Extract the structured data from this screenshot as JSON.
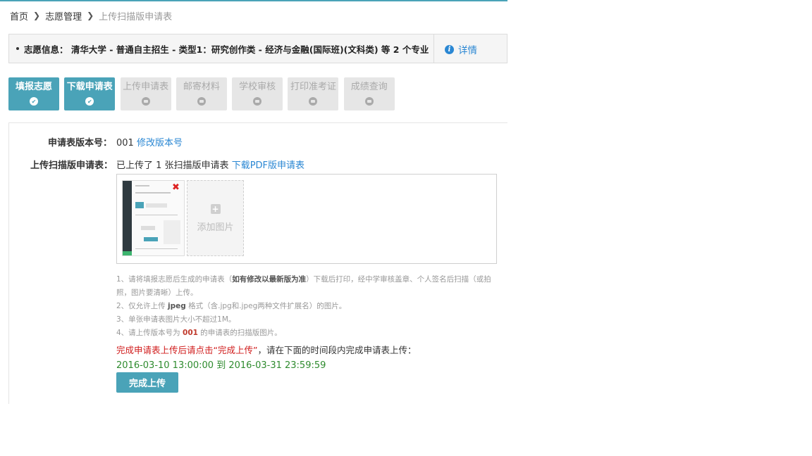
{
  "breadcrumb": {
    "items": [
      "首页",
      "志愿管理",
      "上传扫描版申请表"
    ]
  },
  "info_bar": {
    "text": "志愿信息： 清华大学 - 普通自主招生 - 类型1：研究创作类 - 经济与金融(国际班)(文科类) 等 2 个专业",
    "detail_label": "详情",
    "detail_icon": "info-icon"
  },
  "steps": [
    {
      "label": "填报志愿",
      "status": "done"
    },
    {
      "label": "下载申请表",
      "status": "done"
    },
    {
      "label": "上传申请表",
      "status": "pending"
    },
    {
      "label": "邮寄材料",
      "status": "pending"
    },
    {
      "label": "学校审核",
      "status": "pending"
    },
    {
      "label": "打印准考证",
      "status": "pending"
    },
    {
      "label": "成绩查询",
      "status": "pending"
    }
  ],
  "form": {
    "version_label": "申请表版本号：",
    "version_value": "001",
    "version_link": "修改版本号",
    "upload_label": "上传扫描版申请表：",
    "upload_status": "已上传了 1 张扫描版申请表",
    "download_link": "下载PDF版申请表",
    "add_image_label": "添加图片"
  },
  "notes": {
    "n1_a": "1、请将填报志愿后生成的申请表（",
    "n1_b": "如有修改以最新版为准",
    "n1_c": "）下载后打印，经中学审核盖章、个人签名后扫描（或拍照，图片要清晰）上传。",
    "n2_a": "2、仅允许上传 ",
    "n2_b": "jpeg",
    "n2_c": " 格式（含.jpg和.jpeg两种文件扩展名）的图片。",
    "n3": "3、单张申请表图片大小不超过1M。",
    "n4_a": "4、请上传版本号为 ",
    "n4_b": "001",
    "n4_c": " 的申请表的扫描版图片。"
  },
  "warning": {
    "red": "完成申请表上传后请点击“完成上传”",
    "dark": "，请在下面的时间段内完成申请表上传："
  },
  "time_range": "2016-03-10 13:00:00 到 2016-03-31 23:59:59",
  "finish_button": "完成上传",
  "colors": {
    "accent": "#4aa3b8",
    "link": "#2a87d3",
    "warning": "#d01b1b",
    "time": "#2e8b2e"
  }
}
